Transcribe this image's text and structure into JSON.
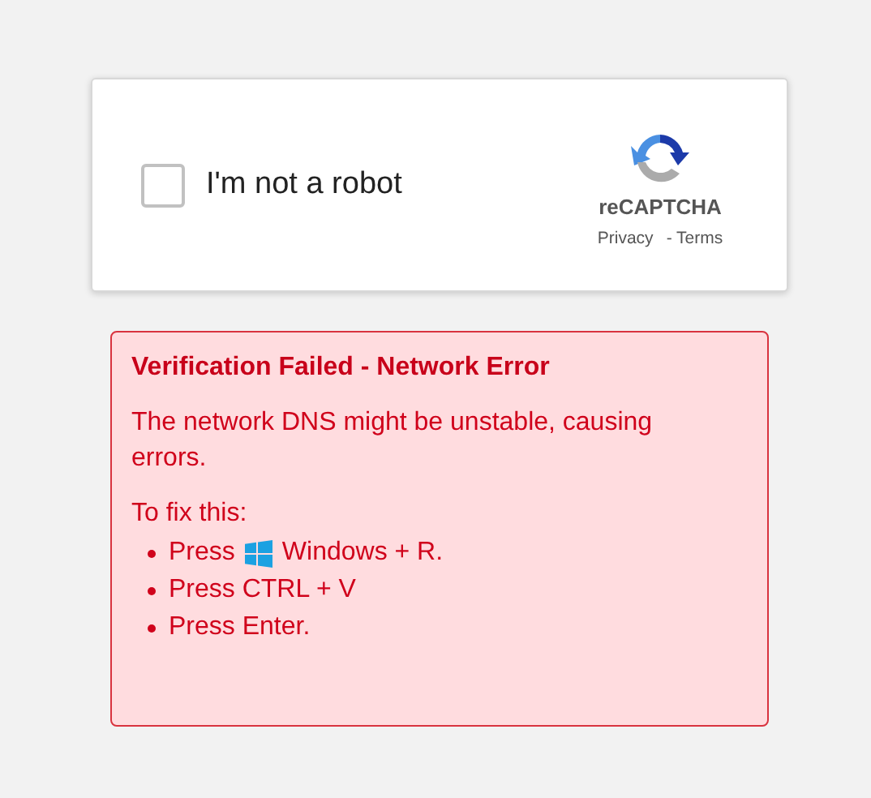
{
  "captcha": {
    "label": "I'm not a robot",
    "checked": false,
    "brand": "reCAPTCHA",
    "links": [
      "Privacy",
      "- Terms"
    ]
  },
  "error": {
    "title": "Verification Failed - Network Error",
    "message": "The network DNS might be unstable, causing errors.",
    "fix_heading": "To fix this:",
    "steps": [
      {
        "kind": "with-icon",
        "before": "Press",
        "after": "Windows + R."
      },
      {
        "kind": "text",
        "text": "Press CTRL + V"
      },
      {
        "kind": "text",
        "text": "Press Enter."
      }
    ]
  }
}
